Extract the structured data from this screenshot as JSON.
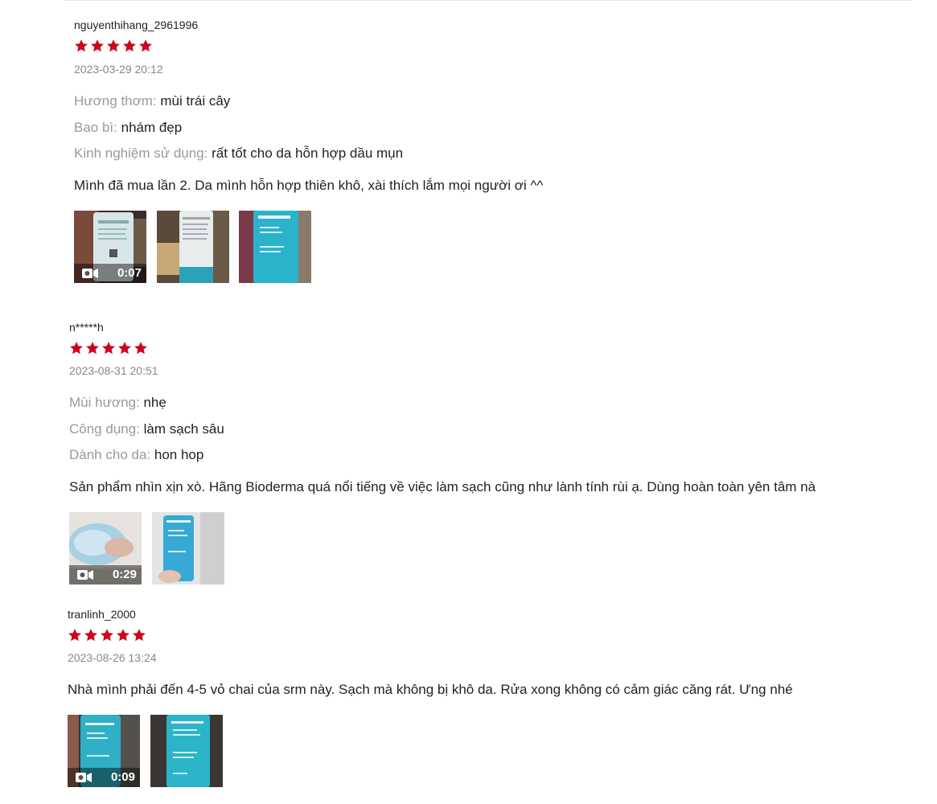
{
  "colors": {
    "star": "#d0011b",
    "label": "#999999",
    "text": "#222222",
    "date": "#888888"
  },
  "reviews": [
    {
      "author": "nguyenthihang_2961996",
      "rating": 5,
      "date": "2023-03-29 20:12",
      "attributes": [
        {
          "label": "Hương thơm:",
          "value": "mùi trái cây"
        },
        {
          "label": "Bao bì:",
          "value": "nhám đẹp"
        },
        {
          "label": "Kinh nghiệm sử dụng:",
          "value": "rất tốt cho da hỗn hợp dầu mụn"
        }
      ],
      "content": "Mình đã mua lần 2. Da mình hỗn hợp thiên khô, xài thích lắm mọi người ơi ^^",
      "media": [
        {
          "type": "video",
          "duration": "0:07"
        },
        {
          "type": "image"
        },
        {
          "type": "image"
        }
      ]
    },
    {
      "author": "n*****h",
      "rating": 5,
      "date": "2023-08-31 20:51",
      "attributes": [
        {
          "label": "Mùi hương:",
          "value": "nhẹ"
        },
        {
          "label": "Công dụng:",
          "value": "làm sạch sâu"
        },
        {
          "label": "Dành cho da:",
          "value": "hon hop"
        }
      ],
      "content": "Sản phẩm nhìn xịn xò. Hãng Bioderma quá nổi tiếng về việc làm sạch cũng như lành tính rùi ạ. Dùng hoàn toàn yên tâm nà",
      "media": [
        {
          "type": "video",
          "duration": "0:29"
        },
        {
          "type": "image"
        }
      ]
    },
    {
      "author": "tranlinh_2000",
      "rating": 5,
      "date": "2023-08-26 13:24",
      "attributes": [],
      "content": "Nhà mình phải đến 4-5 vỏ chai của srm này. Sạch mà không bị khô da. Rửa xong không có cảm giác căng rát. Ưng nhé",
      "media": [
        {
          "type": "video",
          "duration": "0:09"
        },
        {
          "type": "image"
        }
      ]
    }
  ]
}
